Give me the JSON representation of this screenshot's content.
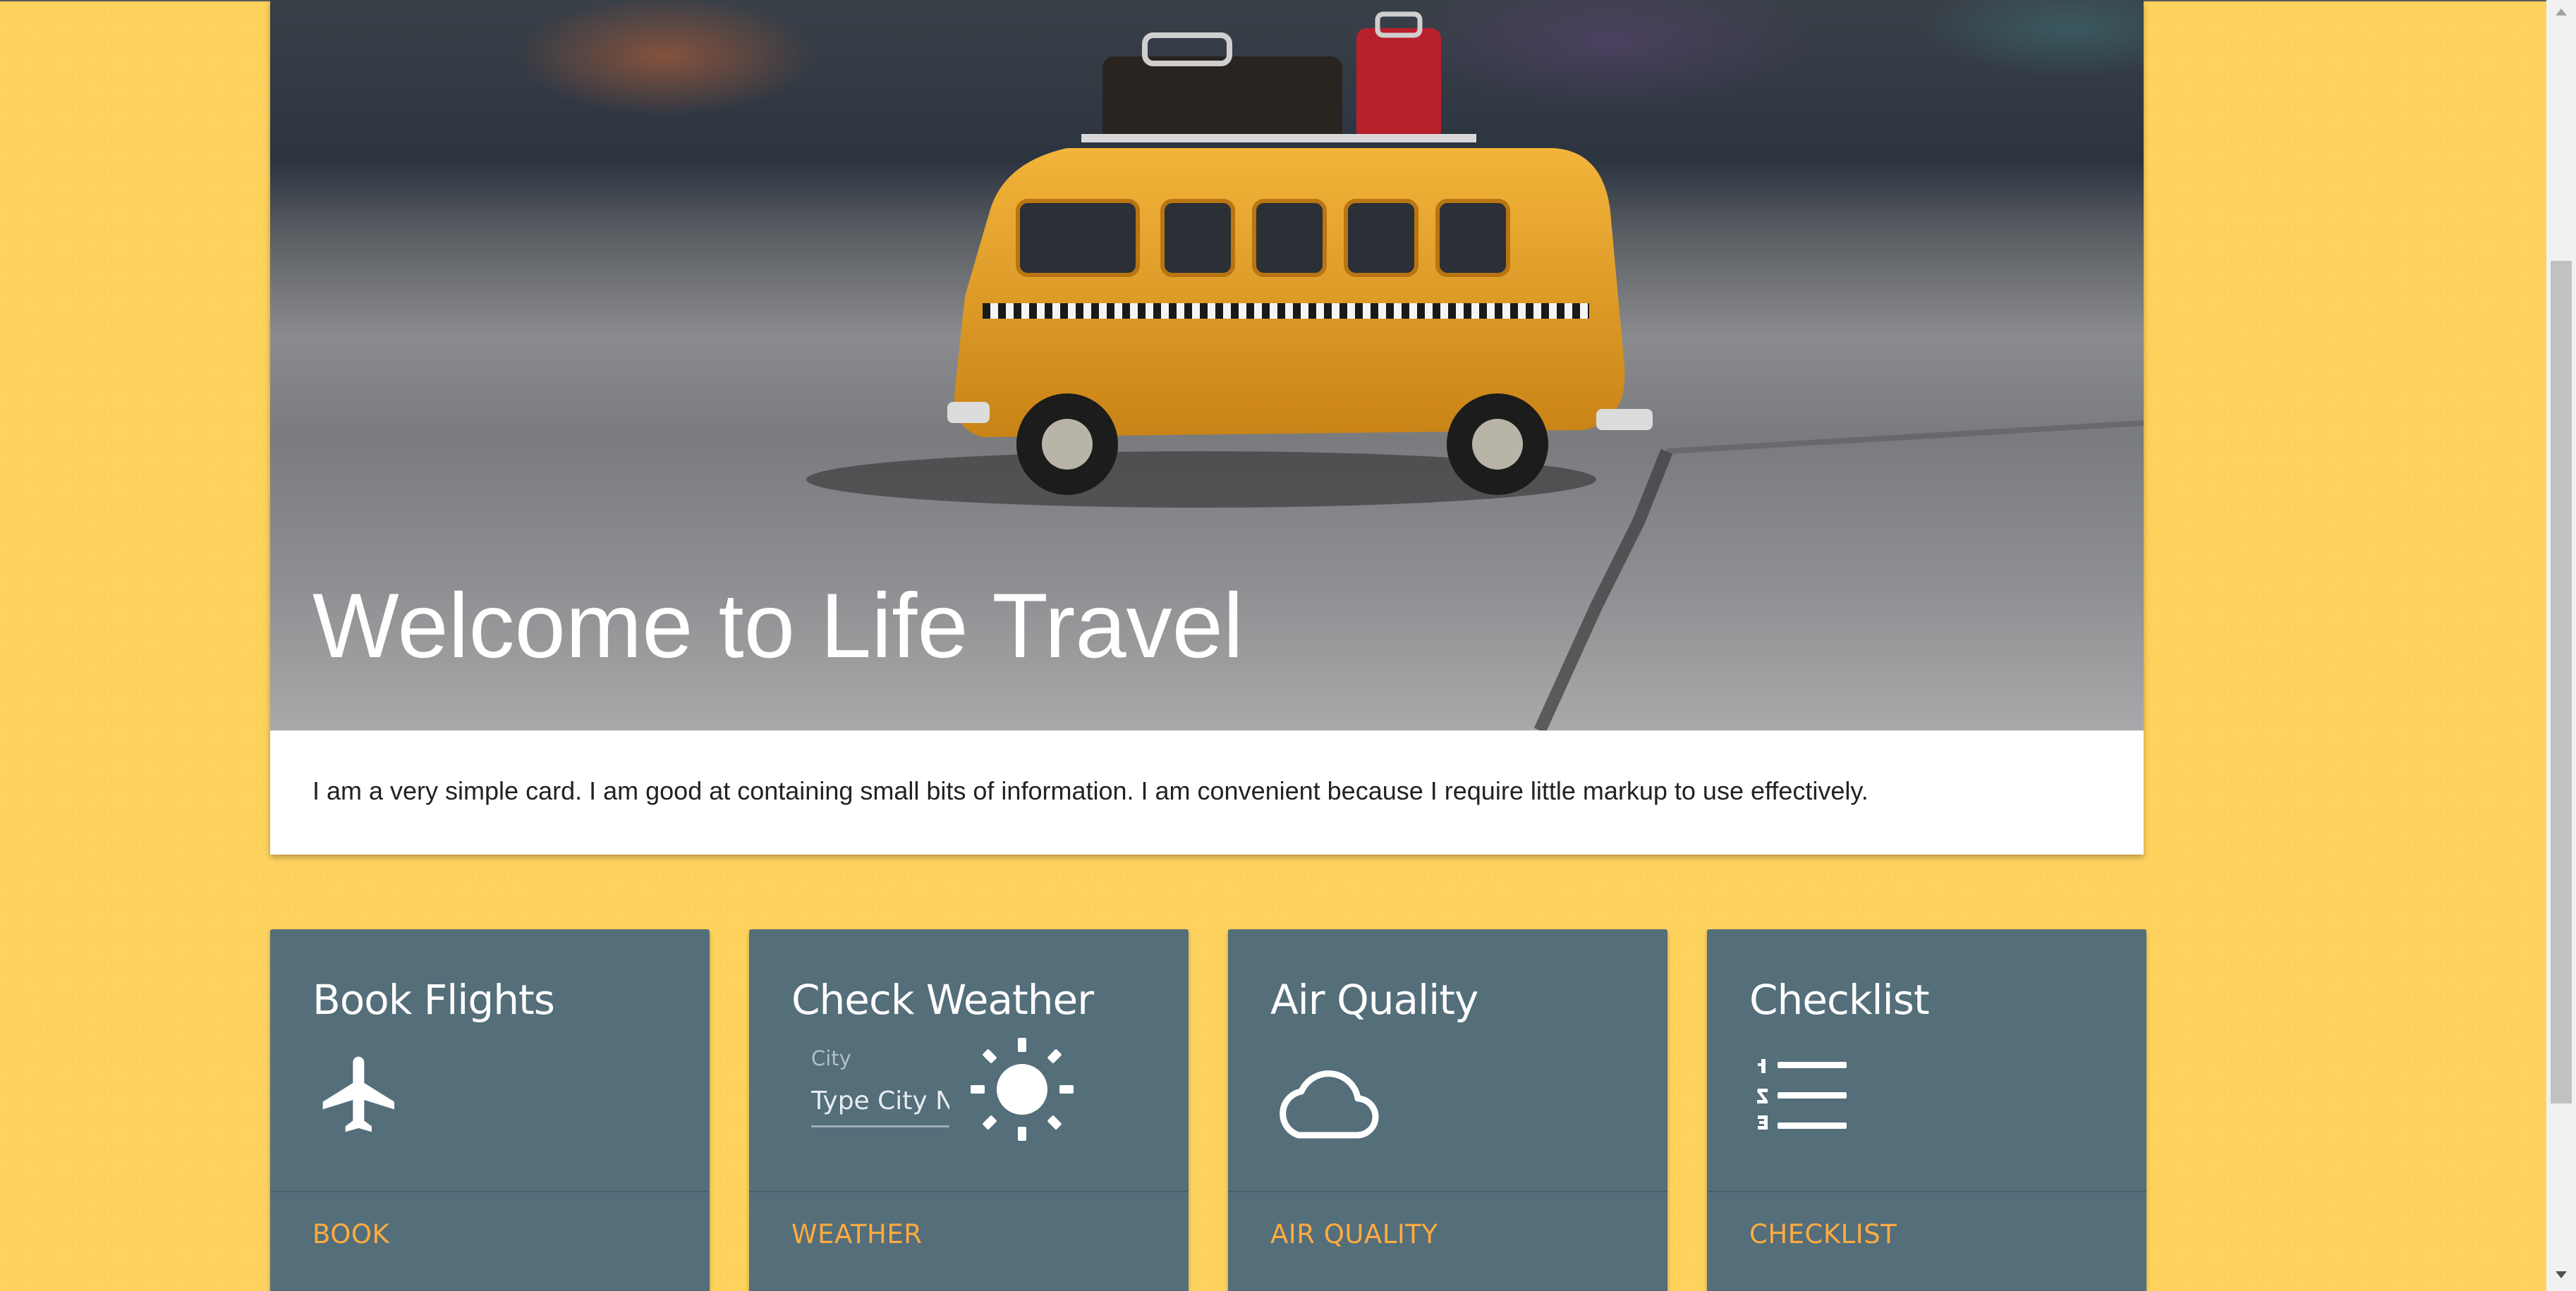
{
  "hero": {
    "image_alt": "Toy yellow van with luggage on roof",
    "title": "Welcome to Life Travel",
    "text": "I am a very simple card. I am good at containing small bits of information. I am convenient because I require little markup to use effectively."
  },
  "cards": [
    {
      "title": "Book Flights",
      "icon": "airplane-icon",
      "action": "BOOK"
    },
    {
      "title": "Check Weather",
      "icon": "sun-icon",
      "action": "WEATHER",
      "input": {
        "label": "City",
        "placeholder": "Type City Name",
        "value": ""
      }
    },
    {
      "title": "Air Quality",
      "icon": "cloud-icon",
      "action": "AIR QUALITY"
    },
    {
      "title": "Checklist",
      "icon": "numbered-list-icon",
      "action": "CHECKLIST"
    }
  ],
  "colors": {
    "background": "#fdd35e",
    "card": "#546e7a",
    "accent": "#ffab40"
  }
}
